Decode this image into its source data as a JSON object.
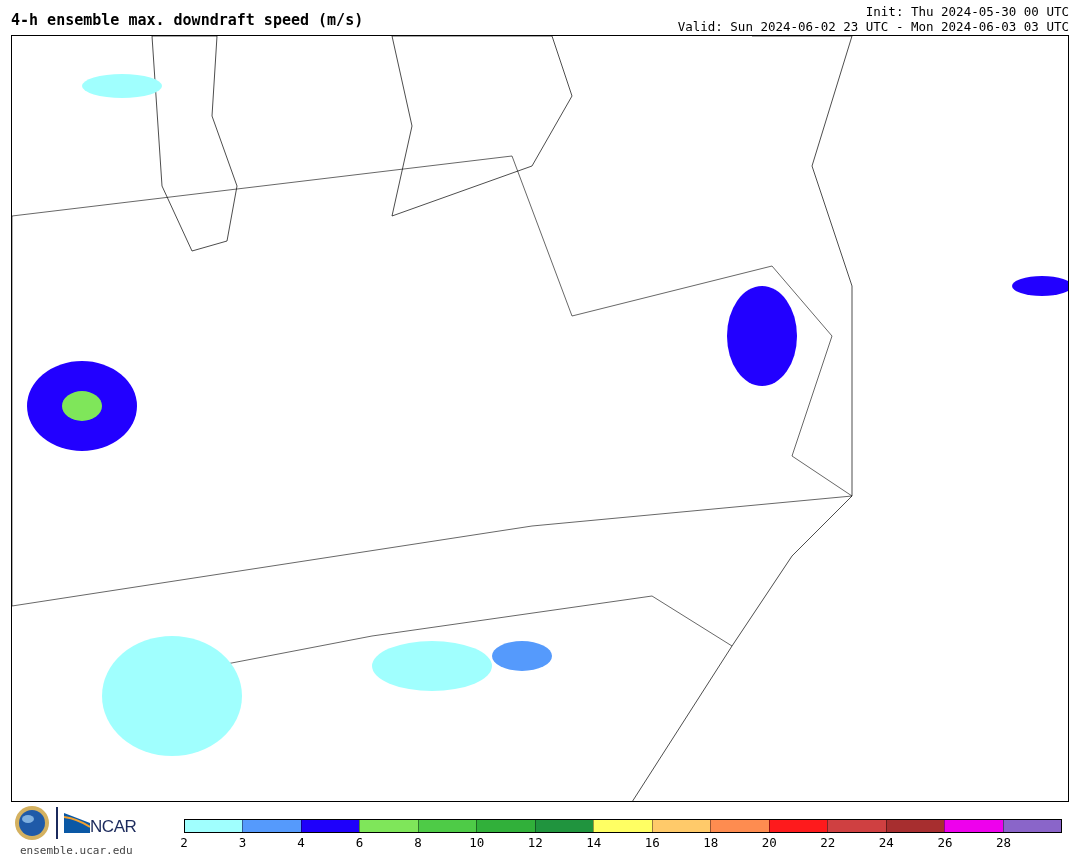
{
  "title": "4-h ensemble max. downdraft speed (m/s)",
  "init": "Init: Thu 2024-05-30 00 UTC",
  "valid": "Valid: Sun 2024-06-02 23 UTC - Mon 2024-06-03 03 UTC",
  "logos": {
    "ncar_text": "NCAR",
    "url": "ensemble.ucar.edu"
  },
  "colorbar": {
    "segments": [
      {
        "color": "#a0fffe"
      },
      {
        "color": "#559afc"
      },
      {
        "color": "#1e00fb"
      },
      {
        "color": "#7fe65a"
      },
      {
        "color": "#4ecb47"
      },
      {
        "color": "#31b03a"
      },
      {
        "color": "#20943e"
      },
      {
        "color": "#ffff63"
      },
      {
        "color": "#ffca6a"
      },
      {
        "color": "#fe8c50"
      },
      {
        "color": "#fe1a1c"
      },
      {
        "color": "#cf4041"
      },
      {
        "color": "#a72e2f"
      },
      {
        "color": "#ee00ed"
      },
      {
        "color": "#8a65c9"
      }
    ],
    "ticks": [
      "2",
      "3",
      "4",
      "6",
      "8",
      "10",
      "12",
      "14",
      "16",
      "18",
      "20",
      "22",
      "24",
      "26",
      "28"
    ]
  }
}
